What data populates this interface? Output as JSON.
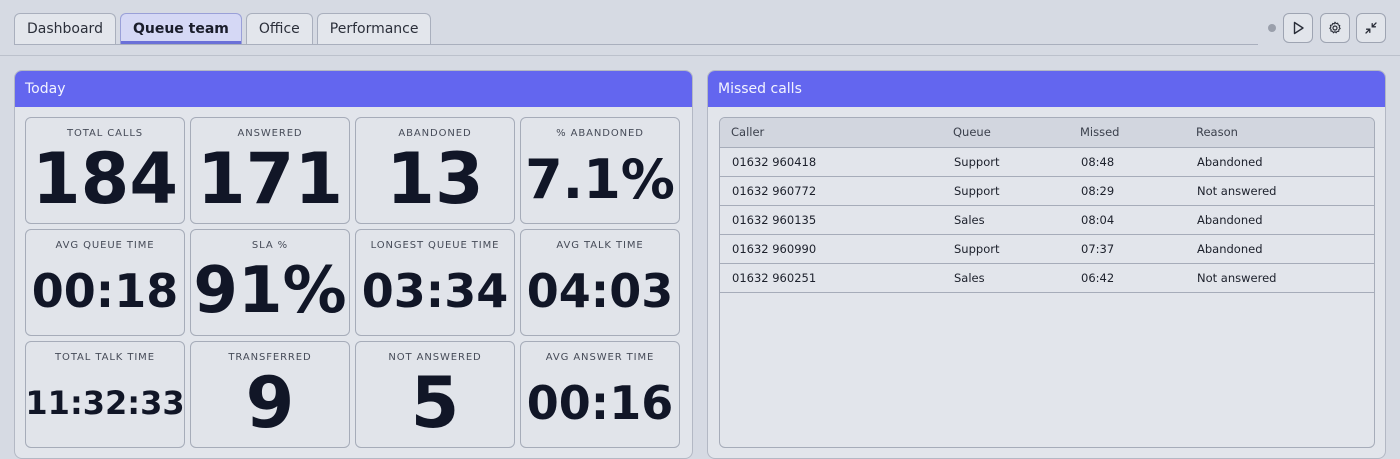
{
  "tabs": [
    {
      "label": "Dashboard"
    },
    {
      "label": "Queue team"
    },
    {
      "label": "Office"
    },
    {
      "label": "Performance"
    }
  ],
  "toolbar": {
    "icons": [
      "status-dot",
      "play-icon",
      "gear-icon",
      "collapse-icon"
    ]
  },
  "today": {
    "title": "Today",
    "stats": [
      {
        "label": "TOTAL CALLS",
        "value": "184"
      },
      {
        "label": "ANSWERED",
        "value": "171"
      },
      {
        "label": "ABANDONED",
        "value": "13"
      },
      {
        "label": "% ABANDONED",
        "value": "7.1%"
      },
      {
        "label": "AVG QUEUE TIME",
        "value": "00:18"
      },
      {
        "label": "SLA %",
        "value": "91%"
      },
      {
        "label": "LONGEST QUEUE TIME",
        "value": "03:34"
      },
      {
        "label": "AVG TALK TIME",
        "value": "04:03"
      },
      {
        "label": "TOTAL TALK TIME",
        "value": "11:32:33"
      },
      {
        "label": "TRANSFERRED",
        "value": "9"
      },
      {
        "label": "NOT ANSWERED",
        "value": "5"
      },
      {
        "label": "AVG ANSWER TIME",
        "value": "00:16"
      }
    ]
  },
  "missed": {
    "title": "Missed calls",
    "columns": [
      "Caller",
      "Queue",
      "Missed",
      "Reason"
    ],
    "rows": [
      [
        "01632 960418",
        "Support",
        "08:48",
        "Abandoned"
      ],
      [
        "01632 960772",
        "Support",
        "08:29",
        "Not answered"
      ],
      [
        "01632 960135",
        "Sales",
        "08:04",
        "Abandoned"
      ],
      [
        "01632 960990",
        "Support",
        "07:37",
        "Abandoned"
      ],
      [
        "01632 960251",
        "Sales",
        "06:42",
        "Not answered"
      ]
    ]
  },
  "colors": {
    "accent": "#6366ef",
    "background": "#d6dae3"
  }
}
